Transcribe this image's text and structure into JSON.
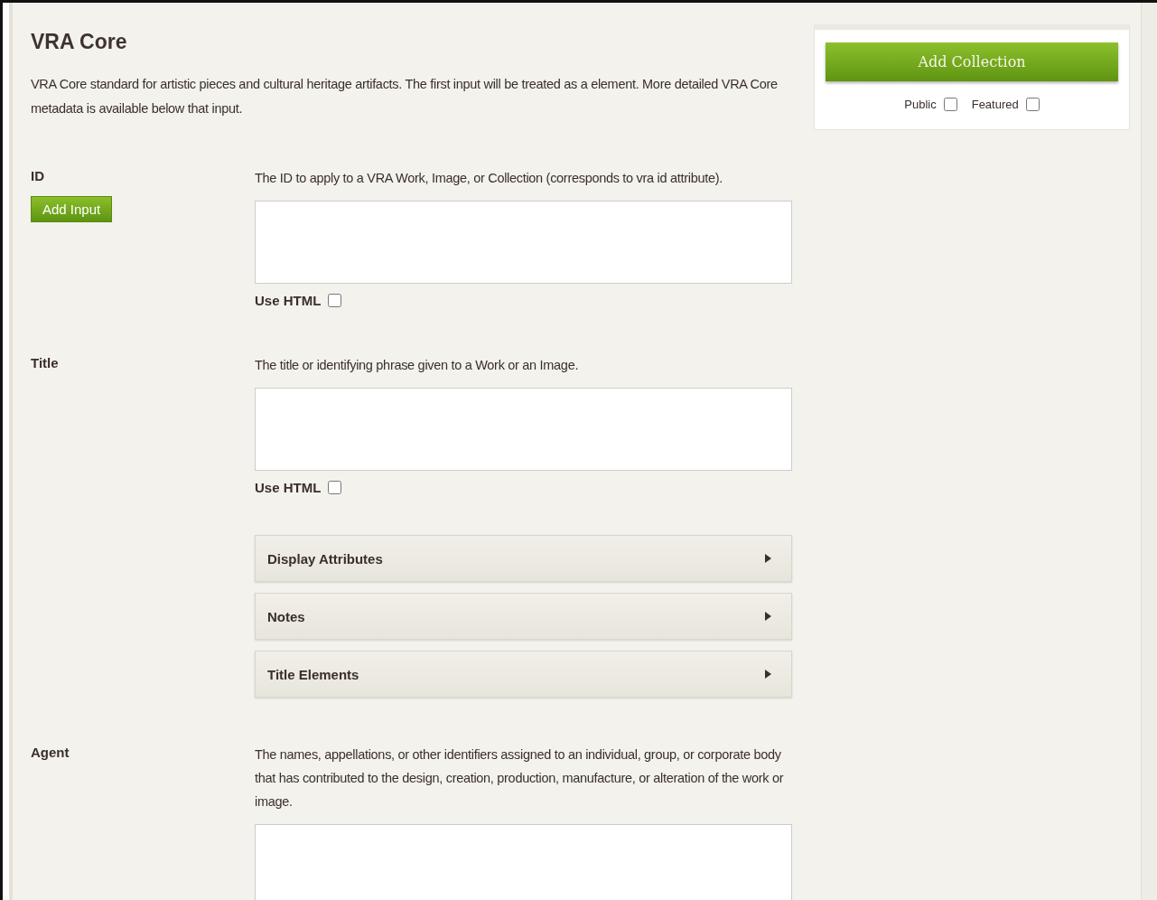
{
  "section": {
    "title": "VRA Core",
    "description": "VRA Core standard for artistic pieces and cultural heritage artifacts. The first input will be treated as a element. More detailed VRA Core metadata is available below that input."
  },
  "fields": [
    {
      "label": "ID",
      "add_button": "Add Input",
      "description": "The ID to apply to a VRA Work, Image, or Collection (corresponds to vra id attribute).",
      "use_html": {
        "label": "Use HTML",
        "checked": false
      }
    },
    {
      "label": "Title",
      "description": "The title or identifying phrase given to a Work or an Image.",
      "use_html": {
        "label": "Use HTML",
        "checked": false
      },
      "sections": [
        {
          "label": "Display Attributes",
          "expanded": false
        },
        {
          "label": "Notes",
          "expanded": false
        },
        {
          "label": "Title Elements",
          "expanded": false
        }
      ]
    },
    {
      "label": "Agent",
      "description": "The names, appellations, or other identifiers assigned to an individual, group, or corporate body that has contributed to the design, creation, production, manufacture, or alteration of the work or image."
    }
  ],
  "sidebar": {
    "button": "Add Collection",
    "options": [
      {
        "label": "Public",
        "checked": false
      },
      {
        "label": "Featured",
        "checked": false
      }
    ]
  }
}
